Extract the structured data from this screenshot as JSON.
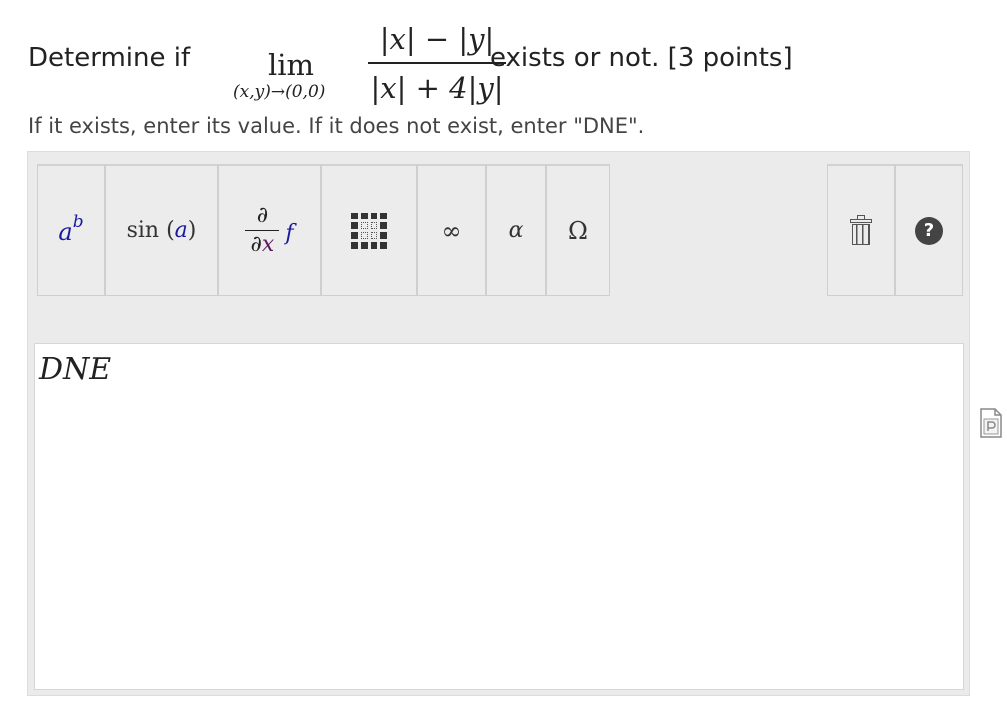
{
  "question": {
    "lead": "Determine if",
    "lim_label": "lim",
    "lim_subscript": "(x,y)→(0,0)",
    "numerator": "|x| − |y|",
    "denominator": "|x| + 4|y|",
    "trailing": "exists or not. [3 points]"
  },
  "instruction": "If it exists, enter its value. If it does not exist, enter \"DNE\".",
  "toolbar": {
    "buttons": [
      {
        "name": "power",
        "base": "a",
        "exp": "b"
      },
      {
        "name": "function",
        "fn": "sin",
        "open": " (",
        "arg": "a",
        "close": ")"
      },
      {
        "name": "derivative",
        "num": "∂",
        "den_prefix": "∂",
        "den_var": "x",
        "fn": "f"
      },
      {
        "name": "matrix",
        "icon": "matrix-icon"
      },
      {
        "name": "infinity",
        "glyph": "∞"
      },
      {
        "name": "greek-lowercase",
        "glyph": "α"
      },
      {
        "name": "greek-uppercase",
        "glyph": "Ω"
      },
      {
        "name": "clear",
        "icon": "trash-icon"
      },
      {
        "name": "help",
        "glyph": "?"
      }
    ]
  },
  "answer": {
    "value": "DNE"
  },
  "side_icon": "document-icon",
  "colors": {
    "editor_bg": "#ebebeb",
    "variable_blue": "#1a1aa0",
    "variable_purple": "#5a1a5a"
  }
}
